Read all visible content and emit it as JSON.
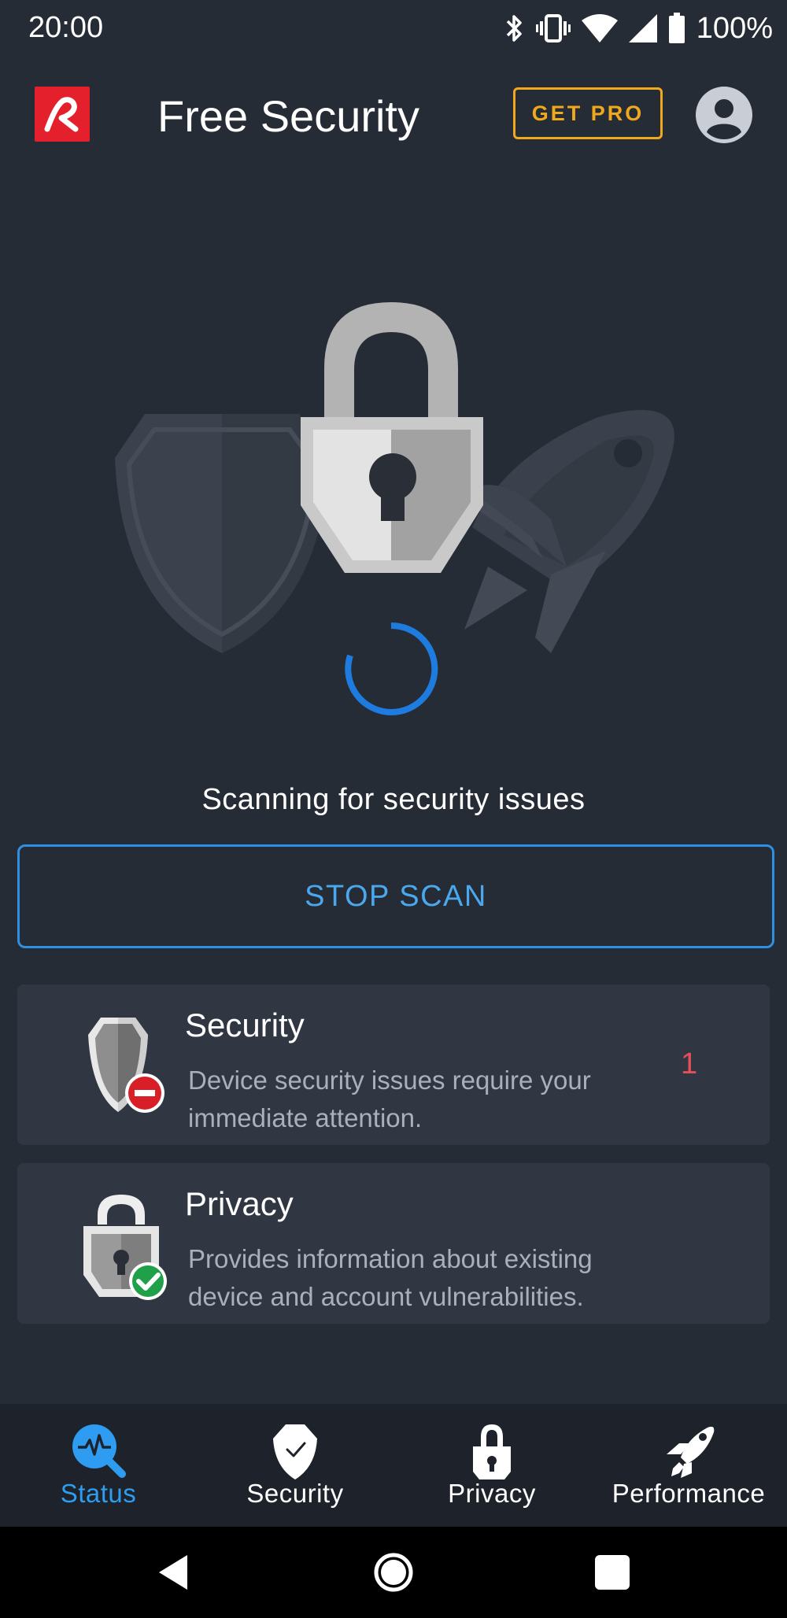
{
  "status_bar": {
    "time": "20:00",
    "battery": "100%",
    "icons": [
      "bluetooth-icon",
      "vibrate-icon",
      "wifi-icon",
      "signal-icon",
      "battery-icon"
    ]
  },
  "header": {
    "title": "Free Security",
    "get_pro_label": "GET PRO",
    "logo": "avira-logo",
    "avatar": "account-icon"
  },
  "scan": {
    "status_text": "Scanning for security issues",
    "stop_label": "STOP SCAN"
  },
  "cards": [
    {
      "title": "Security",
      "description": "Device security issues require your immediate attention.",
      "count": "1",
      "icon": "shield-warning-icon"
    },
    {
      "title": "Privacy",
      "description": "Provides information about existing device and account vulnerabilities.",
      "icon": "lock-check-icon"
    }
  ],
  "bottom_nav": [
    {
      "label": "Status",
      "icon": "status-search-icon",
      "active": true
    },
    {
      "label": "Security",
      "icon": "shield-icon",
      "active": false
    },
    {
      "label": "Privacy",
      "icon": "lock-icon",
      "active": false
    },
    {
      "label": "Performance",
      "icon": "rocket-icon",
      "active": false
    }
  ],
  "colors": {
    "background": "#262c35",
    "card": "#303742",
    "accent_blue": "#2e9cf0",
    "pro_orange": "#f0a81c",
    "brand_red": "#e3202b",
    "alert_red": "#e4505a"
  }
}
